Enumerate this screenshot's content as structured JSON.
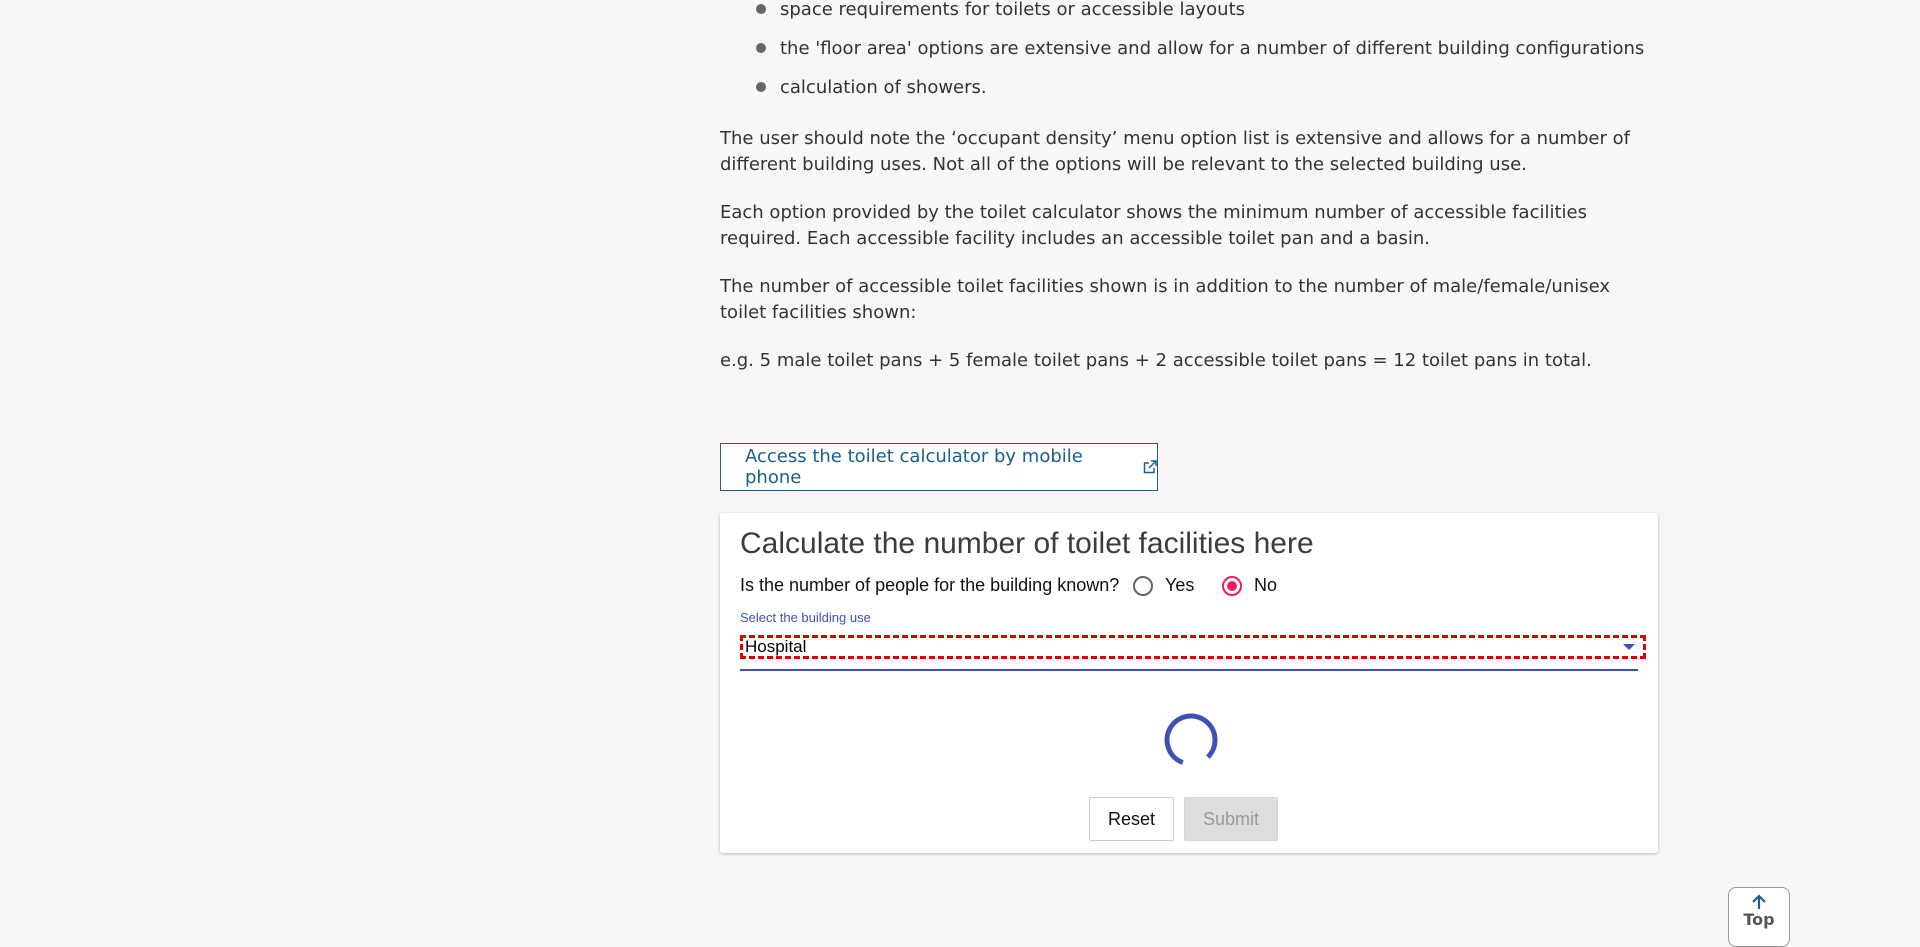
{
  "bullets": [
    "space requirements for toilets or accessible layouts",
    "the 'floor area' options are extensive and allow for a number of different building configurations",
    "calculation of showers."
  ],
  "paragraphs": [
    "The user should note the ‘occupant density’ menu option list is extensive and allows for a number of different building uses. Not all of the options will be relevant to the selected building use.",
    "Each option provided by the toilet calculator shows the minimum number of accessible facilities required. Each accessible facility includes an accessible toilet pan and a basin.",
    "The number of accessible toilet facilities shown is in addition to the number of male/female/unisex toilet facilities shown:",
    "e.g. 5 male toilet pans + 5 female toilet pans + 2 accessible toilet pans = 12 toilet pans in total."
  ],
  "mobile_link": {
    "label": "Access the toilet calculator by mobile phone",
    "icon": "external-link-icon"
  },
  "calculator": {
    "title": "Calculate the number of toilet facilities here",
    "question": "Is the number of people for the building known?",
    "options": [
      "Yes",
      "No"
    ],
    "selected_option": "No",
    "select_label": "Select the building use",
    "select_value": "Hospital",
    "reset_label": "Reset",
    "submit_label": "Submit",
    "accent_color": "#3f51b5",
    "radio_color": "#e91e63"
  },
  "top_button": {
    "label": "Top",
    "icon": "arrow-up-icon"
  }
}
